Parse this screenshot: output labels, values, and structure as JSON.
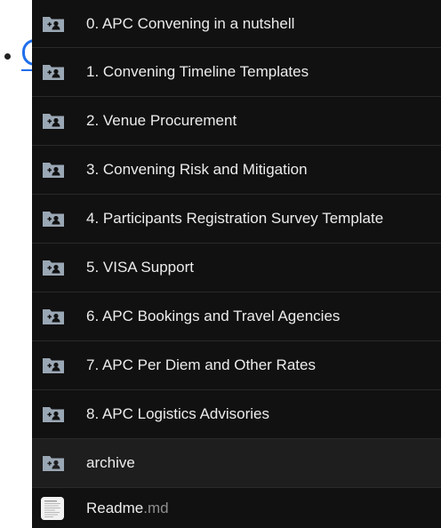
{
  "items": [
    {
      "label": "0. APC Convening in a nutshell",
      "type": "folder-shared"
    },
    {
      "label": "1. Convening Timeline Templates",
      "type": "folder-shared"
    },
    {
      "label": "2. Venue Procurement",
      "type": "folder-shared"
    },
    {
      "label": "3. Convening Risk and Mitigation",
      "type": "folder-shared"
    },
    {
      "label": "4. Participants Registration Survey Template",
      "type": "folder-shared"
    },
    {
      "label": "5. VISA Support",
      "type": "folder-shared"
    },
    {
      "label": "6. APC Bookings and Travel Agencies",
      "type": "folder-shared"
    },
    {
      "label": "7. APC Per Diem and Other Rates",
      "type": "folder-shared"
    },
    {
      "label": "8. APC Logistics Advisories",
      "type": "folder-shared"
    },
    {
      "label": "archive",
      "type": "folder-shared"
    }
  ],
  "readme": {
    "name": "Readme",
    "ext": ".md",
    "type": "document"
  },
  "colors": {
    "panel_bg": "#111111",
    "row_highlight": "#1e1e1e",
    "text": "#ececec",
    "ext_text": "#8e8e8e",
    "folder_icon": "#9aa7b4",
    "link": "#1f6feb"
  }
}
